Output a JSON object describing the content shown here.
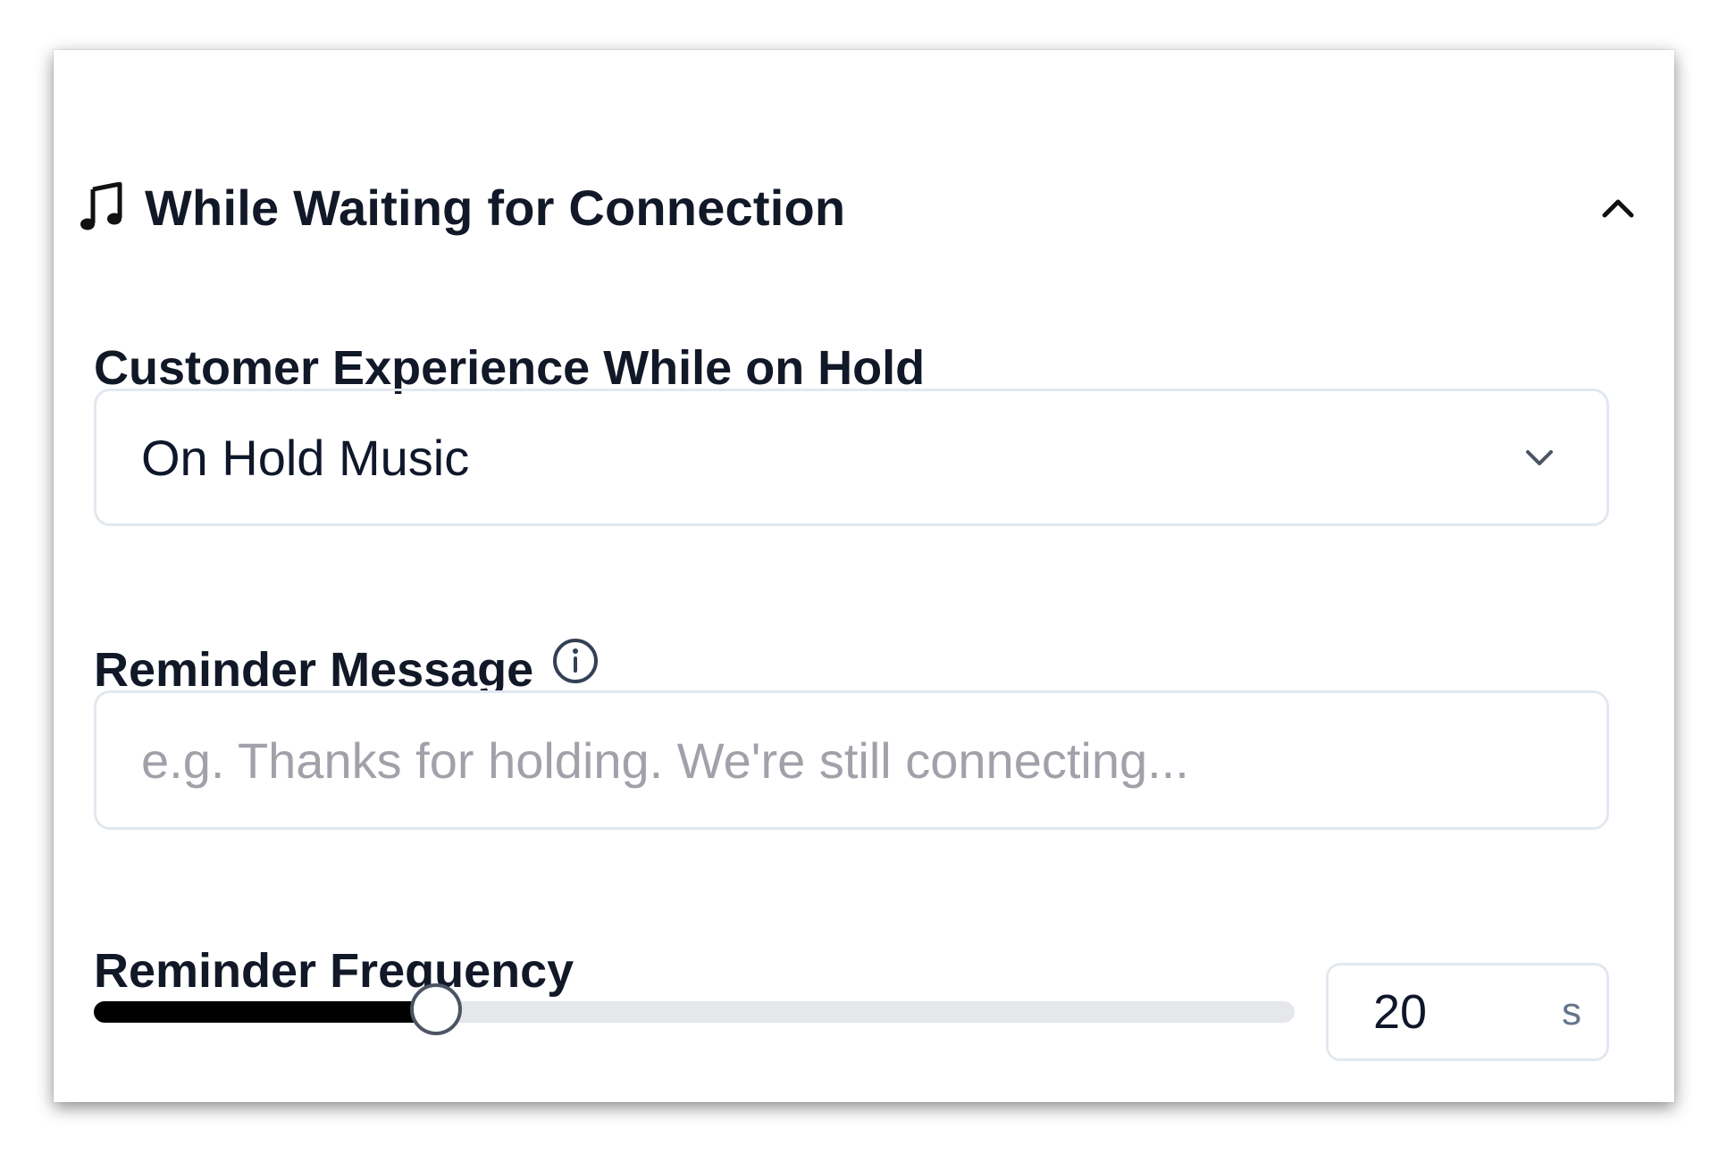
{
  "section": {
    "title": "While Waiting for Connection",
    "icon": "music-note-icon",
    "expanded": true
  },
  "experience": {
    "label": "Customer Experience While on Hold",
    "selected": "On Hold Music"
  },
  "reminder_message": {
    "label": "Reminder Message",
    "placeholder": "e.g. Thanks for holding. We're still connecting...",
    "value": ""
  },
  "reminder_frequency": {
    "label": "Reminder Frequency",
    "value": "20",
    "unit": "s",
    "slider_fraction": 0.285
  },
  "colors": {
    "accent": "#000000",
    "track": "#e5e7eb",
    "border": "#e2e8f0",
    "placeholder": "#a1a1aa"
  }
}
